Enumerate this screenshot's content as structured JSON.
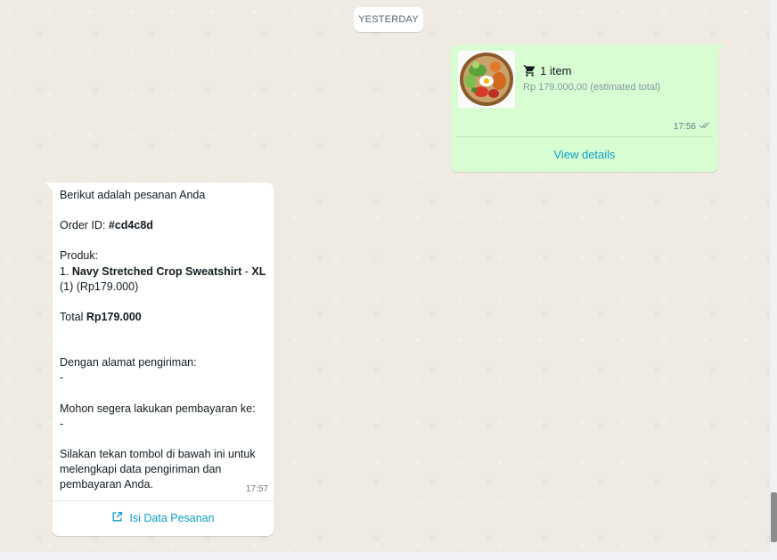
{
  "date_divider": "YESTERDAY",
  "order_card": {
    "item_count": "1 item",
    "price": "Rp 179.000,00 (estimated total)",
    "time": "17:56",
    "action_label": "View details",
    "image": "salad-bowl-thumbnail"
  },
  "order_message": {
    "line_intro": "Berikut adalah pesanan Anda",
    "order_id_label": "Order ID: ",
    "order_id": "#cd4c8d",
    "produk_label": "Produk:",
    "item_prefix": "1. ",
    "item_name": "Navy Stretched Crop Sweatshirt",
    "item_sep": " - ",
    "item_size": "XL",
    "item_qty_price": "(1) (Rp179.000)",
    "total_label": "Total ",
    "total_value": "Rp179.000",
    "address_label": "Dengan alamat pengiriman:",
    "address_value": "-",
    "payment_label": "Mohon segera lakukan pembayaran ke:",
    "payment_value": "-",
    "instructions": "Silakan tekan tombol di bawah ini untuk melengkapi data pengiriman dan pembayaran Anda.",
    "time": "17:57",
    "cta_label": "Isi Data Pesanan"
  },
  "colors": {
    "outgoing_bubble": "#d9fdd3",
    "incoming_bubble": "#ffffff",
    "link": "#0a9fc7",
    "background": "#efeae2"
  }
}
